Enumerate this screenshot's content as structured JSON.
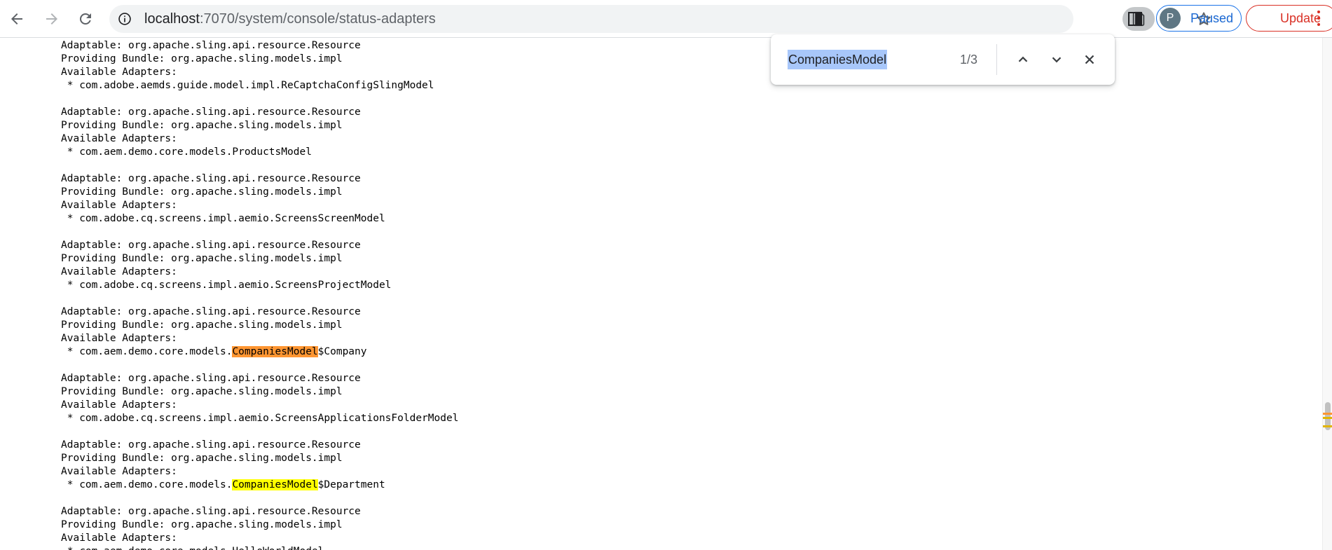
{
  "toolbar": {
    "url_host": "localhost",
    "url_path": ":7070/system/console/status-adapters",
    "profile": {
      "avatar_letter": "P",
      "status": "Paused",
      "color": "#1a73e8"
    },
    "update_label": "Update",
    "update_color": "#d93025",
    "icons": {
      "back": "arrow-left-icon",
      "forward": "arrow-right-icon",
      "reload": "reload-icon",
      "info": "info-icon",
      "find": "find-in-page-icon",
      "share": "share-icon",
      "bookmark": "star-icon",
      "sidepanel": "side-panel-icon",
      "menu": "kebab-menu-icon"
    }
  },
  "find": {
    "query": "CompaniesModel",
    "count": "1/3",
    "active_highlight_color": "#ff9632",
    "highlight_color": "#ffff00"
  },
  "adapters": [
    {
      "adaptable": "Adaptable: org.apache.sling.api.resource.Resource",
      "bundle": "Providing Bundle: org.apache.sling.models.impl",
      "available_label": "Available Adapters:",
      "adapter_prefix": " * com.adobe.aemds.guide.model.impl.ReCaptchaConfigSlingModel",
      "match": "",
      "adapter_suffix": ""
    },
    {
      "adaptable": "Adaptable: org.apache.sling.api.resource.Resource",
      "bundle": "Providing Bundle: org.apache.sling.models.impl",
      "available_label": "Available Adapters:",
      "adapter_prefix": " * com.aem.demo.core.models.ProductsModel",
      "match": "",
      "adapter_suffix": ""
    },
    {
      "adaptable": "Adaptable: org.apache.sling.api.resource.Resource",
      "bundle": "Providing Bundle: org.apache.sling.models.impl",
      "available_label": "Available Adapters:",
      "adapter_prefix": " * com.adobe.cq.screens.impl.aemio.ScreensScreenModel",
      "match": "",
      "adapter_suffix": ""
    },
    {
      "adaptable": "Adaptable: org.apache.sling.api.resource.Resource",
      "bundle": "Providing Bundle: org.apache.sling.models.impl",
      "available_label": "Available Adapters:",
      "adapter_prefix": " * com.adobe.cq.screens.impl.aemio.ScreensProjectModel",
      "match": "",
      "adapter_suffix": ""
    },
    {
      "adaptable": "Adaptable: org.apache.sling.api.resource.Resource",
      "bundle": "Providing Bundle: org.apache.sling.models.impl",
      "available_label": "Available Adapters:",
      "adapter_prefix": " * com.aem.demo.core.models.",
      "match": "CompaniesModel",
      "match_active": true,
      "adapter_suffix": "$Company"
    },
    {
      "adaptable": "Adaptable: org.apache.sling.api.resource.Resource",
      "bundle": "Providing Bundle: org.apache.sling.models.impl",
      "available_label": "Available Adapters:",
      "adapter_prefix": " * com.adobe.cq.screens.impl.aemio.ScreensApplicationsFolderModel",
      "match": "",
      "adapter_suffix": ""
    },
    {
      "adaptable": "Adaptable: org.apache.sling.api.resource.Resource",
      "bundle": "Providing Bundle: org.apache.sling.models.impl",
      "available_label": "Available Adapters:",
      "adapter_prefix": " * com.aem.demo.core.models.",
      "match": "CompaniesModel",
      "match_active": false,
      "adapter_suffix": "$Department"
    },
    {
      "adaptable": "Adaptable: org.apache.sling.api.resource.Resource",
      "bundle": "Providing Bundle: org.apache.sling.models.impl",
      "available_label": "Available Adapters:",
      "adapter_prefix": " * com.aem.demo.core.models.HelloWorldModel",
      "match": "",
      "adapter_suffix": ""
    }
  ]
}
